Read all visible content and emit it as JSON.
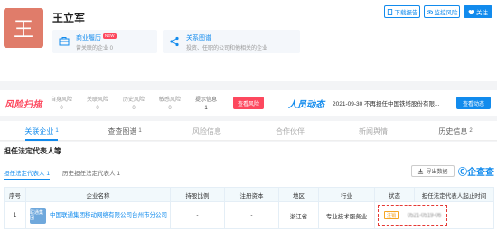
{
  "person": {
    "name": "王立军",
    "avatar_char": "王",
    "avatar_color": "#e07c6a"
  },
  "cards": [
    {
      "title": "商业履历",
      "badge": "NEW",
      "desc": "曾关联的企业 0"
    },
    {
      "title": "关系图谱",
      "desc": "投资、任职的公司和他相关的企业"
    }
  ],
  "actions": {
    "report": "下载报告",
    "monitor": "监控风险",
    "follow": "关注"
  },
  "risk": {
    "logo": "风险扫描",
    "cols": [
      {
        "label": "自身风险",
        "num": "0"
      },
      {
        "label": "关联风险",
        "num": "0"
      },
      {
        "label": "历史风险",
        "num": "0"
      },
      {
        "label": "敏感风险",
        "num": "0"
      },
      {
        "label": "提示信息",
        "num": "1"
      }
    ],
    "button": "查看风险"
  },
  "dynamics": {
    "logo": "人员动态",
    "text": "2021-09-30 不再担任中国铁塔股份有限...",
    "button": "查看动态"
  },
  "tabs": [
    {
      "label": "关联企业",
      "count": "1"
    },
    {
      "label": "查查图谱",
      "count": "1"
    },
    {
      "label": "风险信息",
      "count": ""
    },
    {
      "label": "合作伙伴",
      "count": ""
    },
    {
      "label": "新闻舆情",
      "count": ""
    },
    {
      "label": "历史信息",
      "count": "2"
    }
  ],
  "section": {
    "title": "担任法定代表人等",
    "sub_tabs": [
      {
        "label": "担任法定代表人",
        "count": "1"
      },
      {
        "label": "历史担任法定代表人",
        "count": "1"
      }
    ],
    "export": "导出数据",
    "brand": "企查查"
  },
  "table": {
    "headers": [
      "序号",
      "企业名称",
      "持股比例",
      "注册资本",
      "地区",
      "行业",
      "状态",
      "担任法定代表人起止时间"
    ],
    "rows": [
      {
        "idx": "1",
        "logo_text": "联通集团",
        "name": "中国联通集团移动网络有限公司台州市分公司",
        "share": "-",
        "capital": "-",
        "region": "浙江省",
        "industry": "专业技术服务业",
        "status": "注销",
        "period": "0521-0519-06"
      }
    ]
  },
  "colors": {
    "accent": "#128bed",
    "risk": "#fd485e"
  }
}
